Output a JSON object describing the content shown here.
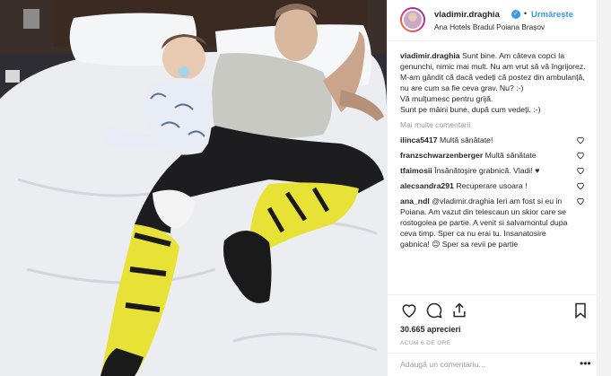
{
  "post": {
    "username": "vladimir.draghia",
    "follow_label": "Urmărește",
    "location": "Ana Hotels Bradul Poiana Brașov",
    "caption_user": "vladimir.draghia",
    "caption_text": "Sunt bine. Am câteva copci la genunchi, nimic mai mult. Nu am vrut să vă îngrijorez. M-am gândit că dacă vedeți că postez din ambulanță, nu are cum sa fie ceva grav. Nu? :-)",
    "caption_line2": "Vă mulțumesc pentru grijă.",
    "caption_line3": "Sunt pe mâini bune, după cum vedeți. :-)",
    "more_comments": "Mai multe comentarii",
    "likes": "30.665 aprecieri",
    "time": "ACUM 6 DE ORE",
    "add_comment_placeholder": "Adaugă un comentariu..."
  },
  "comments": [
    {
      "user": "ilinca5417",
      "text": "Multă sănătate!",
      "liked": true
    },
    {
      "user": "franzschwarzenberger",
      "text": "Multă sănătate",
      "liked": true
    },
    {
      "user": "tfaimosii",
      "text": "Însănătoșire grabnică. Vladi! ♥",
      "liked": true
    },
    {
      "user": "alecsandra291",
      "text": "Recuperare usoara !",
      "liked": true
    },
    {
      "user": "ana_ndl",
      "text": "@vladimir.draghia Ieri am fost si eu in Poiana. Am vazut din telescaun un skior care se rostogolea pe partie. A venit si salvamontul dupa ceva timp. Sper ca nu erai tu. Insanatosire gabnica! 😉 Sper sa revii pe partie",
      "liked": true
    }
  ],
  "icons": {
    "verified": "verified-badge-icon",
    "like": "heart-icon",
    "comment": "comment-icon",
    "share": "share-icon",
    "save": "bookmark-icon",
    "more": "ellipsis-icon"
  },
  "colors": {
    "link": "#3897f0",
    "muted": "#999999",
    "text": "#262626",
    "border": "#efefef"
  }
}
